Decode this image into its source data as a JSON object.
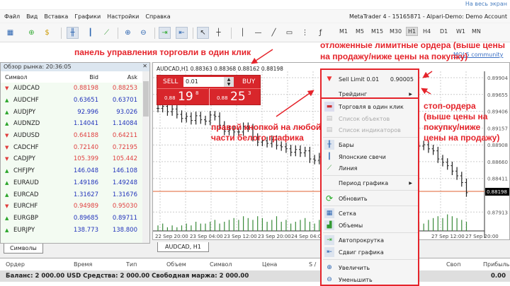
{
  "top": {
    "fullscreen": "На весь экран"
  },
  "menu": [
    "Файл",
    "Вид",
    "Вставка",
    "Графики",
    "Настройки",
    "Справка"
  ],
  "window_title": "MetaTrader 4 - 15165871 - Alpari-Demo: Demo Account",
  "timeframes": [
    "M1",
    "M5",
    "M15",
    "M30",
    "H1",
    "H4",
    "D1",
    "W1",
    "MN"
  ],
  "active_timeframe": "H1",
  "mql_link": "MQL5 community",
  "annotations": {
    "one_click": "панель управления торговли в один клик",
    "limit1": "отложенные лимитные ордера (выше цены",
    "limit2": "на продажу/ниже цены на покупку)",
    "right1": "правой кнопкой на любой",
    "right2": "части белого графика",
    "stop1": "стоп-ордера",
    "stop2": "(выше цены на",
    "stop3": "покупку/ниже",
    "stop4": "цены на продажу)"
  },
  "market_watch": {
    "title": "Обзор рынка: 20:36:05",
    "columns": [
      "Символ",
      "Bid",
      "Ask"
    ],
    "rows": [
      {
        "s": "AUDCAD",
        "bid": "0.88198",
        "ask": "0.88253",
        "dir": "dn"
      },
      {
        "s": "AUDCHF",
        "bid": "0.63651",
        "ask": "0.63701",
        "dir": "up"
      },
      {
        "s": "AUDJPY",
        "bid": "92.996",
        "ask": "93.026",
        "dir": "up"
      },
      {
        "s": "AUDNZD",
        "bid": "1.14041",
        "ask": "1.14084",
        "dir": "up"
      },
      {
        "s": "AUDUSD",
        "bid": "0.64188",
        "ask": "0.64211",
        "dir": "dn"
      },
      {
        "s": "CADCHF",
        "bid": "0.72140",
        "ask": "0.72195",
        "dir": "dn"
      },
      {
        "s": "CADJPY",
        "bid": "105.399",
        "ask": "105.442",
        "dir": "dn"
      },
      {
        "s": "CHFJPY",
        "bid": "146.048",
        "ask": "146.108",
        "dir": "up"
      },
      {
        "s": "EURAUD",
        "bid": "1.49186",
        "ask": "1.49248",
        "dir": "up"
      },
      {
        "s": "EURCAD",
        "bid": "1.31627",
        "ask": "1.31676",
        "dir": "up"
      },
      {
        "s": "EURCHF",
        "bid": "0.94989",
        "ask": "0.95030",
        "dir": "dn"
      },
      {
        "s": "EURGBP",
        "bid": "0.89685",
        "ask": "0.89711",
        "dir": "up"
      },
      {
        "s": "EURJPY",
        "bid": "138.773",
        "ask": "138.800",
        "dir": "up"
      }
    ],
    "tab": "Символы"
  },
  "chart": {
    "header": "AUDCAD,H1  0.88363 0.88368 0.88162 0.88198",
    "tab": "AUDCAD, H1",
    "price_labels": [
      "0.89904",
      "0.89655",
      "0.89406",
      "0.89157",
      "0.88908",
      "0.88660",
      "0.88411",
      "0.88198",
      "0.87913"
    ],
    "current_price": "0.88198",
    "time_labels": [
      "22 Sep 20:00",
      "23 Sep 04:00",
      "23 Sep 12:00",
      "23 Sep 20:00",
      "24 Sep 04:00",
      "27 Sep 12:00",
      "27 Sep 20:00"
    ],
    "closes": [
      0.8945,
      0.8948,
      0.894,
      0.8944,
      0.8936,
      0.893,
      0.8933,
      0.8927,
      0.8934,
      0.8928,
      0.8926,
      0.8935,
      0.8933,
      0.892,
      0.8911,
      0.8913,
      0.891,
      0.891,
      0.8918,
      0.8916,
      0.8902,
      0.8895,
      0.8897,
      0.8893,
      0.8899,
      0.889,
      0.8888,
      0.8885,
      0.888,
      0.8884,
      0.8879,
      0.8882,
      0.887,
      0.8868,
      0.8873,
      0.8872,
      0.8865,
      0.8871,
      0.887,
      0.8862,
      0.8866,
      0.8864,
      0.8869,
      0.8867,
      0.886,
      0.8862,
      0.883,
      0.8866,
      0.887,
      0.886,
      0.8862,
      0.8872,
      0.888,
      0.8885,
      0.889,
      0.8889,
      0.8891,
      0.8885,
      0.8882,
      0.887,
      0.8865,
      0.886,
      0.8852,
      0.8845,
      0.8835,
      0.882
    ],
    "volumes": [
      3,
      4,
      2,
      3,
      2,
      3,
      4,
      3,
      5,
      4,
      4,
      5,
      6,
      4,
      5,
      6,
      7,
      6,
      8,
      7,
      6,
      8,
      7,
      5,
      6,
      8,
      5,
      6,
      4,
      5,
      6,
      7,
      5,
      4,
      6,
      5,
      4,
      6,
      5,
      7,
      6,
      5,
      8,
      6,
      4,
      5,
      9,
      6,
      5,
      4,
      5,
      6,
      5,
      7,
      6,
      5,
      4,
      6,
      7,
      8,
      7,
      9,
      8,
      7,
      6,
      5
    ],
    "colors": {
      "bars": "#222222",
      "volume": "#3a8a3a",
      "price_line": "#e06030"
    }
  },
  "trade_panel": {
    "sell": "SELL",
    "buy": "BUY",
    "lot": "0.01",
    "sell_prefix": "0.88",
    "sell_big": "19",
    "sell_sup": "8",
    "buy_prefix": "0.88",
    "buy_big": "25",
    "buy_sup": "3"
  },
  "context_menu": {
    "sell_limit": "Sell Limit 0.01",
    "sell_limit_price": "0.90005",
    "items": [
      "Трейдинг",
      "Торговля в один клик",
      "Список объектов",
      "Список индикаторов",
      "Бары",
      "Японские свечи",
      "Линия",
      "Период графика",
      "Обновить",
      "Сетка",
      "Объемы",
      "Автопрокрутка",
      "Сдвиг графика",
      "Увеличить",
      "Уменьшить"
    ]
  },
  "terminal": {
    "columns": [
      "Ордер",
      "Время",
      "Тип",
      "Объем",
      "Символ",
      "Цена",
      "S /",
      "Своп",
      "Прибыль"
    ],
    "balance": "Баланс: 2 000.00 USD  Средства: 2 000.00  Свободная маржа: 2 000.00",
    "profit": "0.00"
  }
}
